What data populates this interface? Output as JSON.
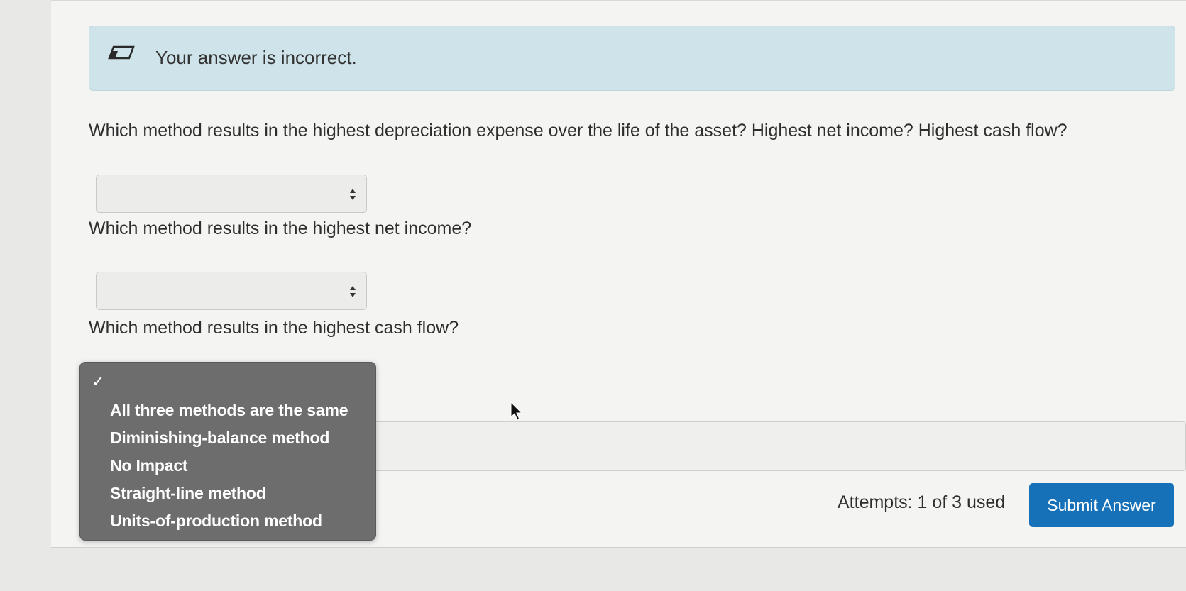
{
  "banner": {
    "text": "Your answer is incorrect.",
    "icon": "eraser-icon"
  },
  "questions": {
    "main": "Which method results in the highest depreciation expense over the life of the asset? Highest net income? Highest cash flow?",
    "net_income": "Which method results in the highest net income?",
    "cash_flow": "Which method results in the highest cash flow?"
  },
  "selects": [
    {
      "value": ""
    },
    {
      "value": ""
    }
  ],
  "dropdown": {
    "selected_indicator": "✓",
    "options": [
      "All three methods are the same",
      "Diminishing-balance method",
      "No Impact",
      "Straight-line method",
      "Units-of-production method"
    ]
  },
  "footer": {
    "attempts": "Attempts: 1 of 3 used",
    "submit_label": "Submit Answer"
  },
  "colors": {
    "banner_bg": "#cfe4ea",
    "dropdown_bg": "#6d6d6d",
    "submit_bg": "#1671b8"
  }
}
